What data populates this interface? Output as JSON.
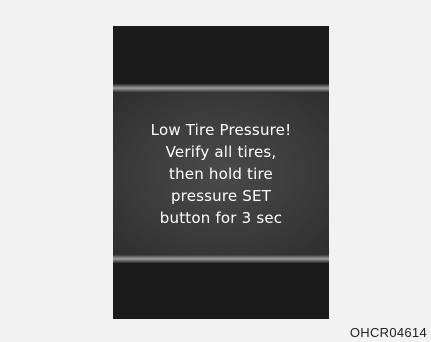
{
  "display": {
    "message_lines": [
      "Low Tire Pressure!",
      "Verify all tires,",
      "then hold tire",
      "pressure SET",
      "button for 3 sec"
    ]
  },
  "figure_code": "OHCR04614",
  "colors": {
    "page_background": "#f2f2f2",
    "screen_background": "#1b1b1b",
    "message_panel": "#3a3a3a",
    "text": "#ffffff"
  }
}
